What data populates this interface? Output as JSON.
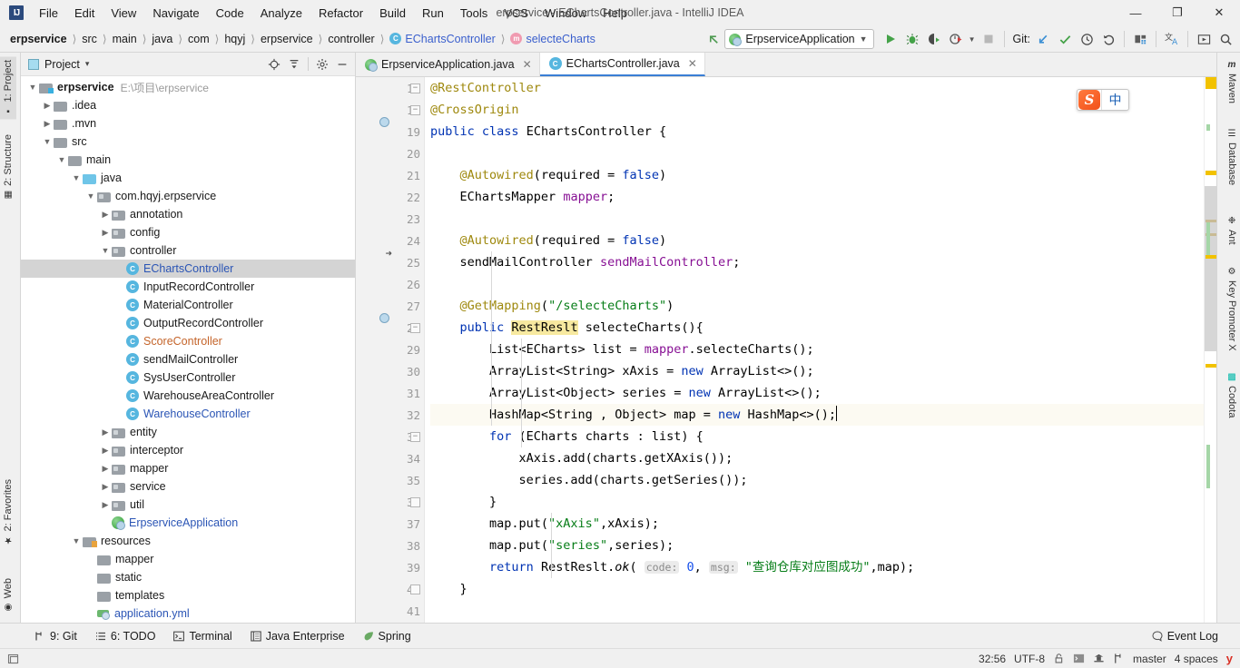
{
  "window": {
    "title": "erpservice - EChartsController.java - IntelliJ IDEA",
    "app_logo": "IJ",
    "minimize": "—",
    "maximize": "❐",
    "close": "✕"
  },
  "menubar": [
    {
      "label": "File",
      "mnemonic": "F"
    },
    {
      "label": "Edit",
      "mnemonic": "E"
    },
    {
      "label": "View",
      "mnemonic": "V"
    },
    {
      "label": "Navigate",
      "mnemonic": "N"
    },
    {
      "label": "Code",
      "mnemonic": "C"
    },
    {
      "label": "Analyze",
      "mnemonic": "z"
    },
    {
      "label": "Refactor",
      "mnemonic": "R"
    },
    {
      "label": "Build",
      "mnemonic": "B"
    },
    {
      "label": "Run",
      "mnemonic": "u"
    },
    {
      "label": "Tools",
      "mnemonic": "T"
    },
    {
      "label": "VCS",
      "mnemonic": "S"
    },
    {
      "label": "Window",
      "mnemonic": "W"
    },
    {
      "label": "Help",
      "mnemonic": "H"
    }
  ],
  "breadcrumbs": [
    {
      "label": "erpservice",
      "style": "bold"
    },
    {
      "label": "src",
      "style": "plain"
    },
    {
      "label": "main",
      "style": "plain"
    },
    {
      "label": "java",
      "style": "plain"
    },
    {
      "label": "com",
      "style": "plain"
    },
    {
      "label": "hqyj",
      "style": "plain"
    },
    {
      "label": "erpservice",
      "style": "plain"
    },
    {
      "label": "controller",
      "style": "plain"
    },
    {
      "label": "EChartsController",
      "style": "class",
      "icon": "C"
    },
    {
      "label": "selecteCharts",
      "style": "method",
      "icon": "m"
    }
  ],
  "toolbar": {
    "run_config": "ErpserviceApplication",
    "git_label": "Git:",
    "icons": [
      "back-arrow-icon",
      "run-icon",
      "debug-icon",
      "run-coverage-icon",
      "profile-icon",
      "stop-icon",
      "update-project-icon",
      "commit-icon",
      "history-icon",
      "rollback-icon",
      "project-structure-icon",
      "translate-icon",
      "presentation-icon",
      "search-everywhere-icon"
    ]
  },
  "left_strip": [
    {
      "label": "1: Project",
      "num": "1",
      "active": true,
      "icon": "project-icon"
    },
    {
      "label": "2: Structure",
      "num": "2",
      "active": false,
      "icon": "structure-icon"
    },
    {
      "label": "2: Favorites",
      "num": "2",
      "active": false,
      "icon": "star-icon"
    },
    {
      "label": "Web",
      "num": "",
      "active": false,
      "icon": "web-icon"
    }
  ],
  "right_strip": [
    {
      "label": "Maven",
      "icon": "maven-icon"
    },
    {
      "label": "Database",
      "icon": "database-icon"
    },
    {
      "label": "Ant",
      "icon": "ant-icon"
    },
    {
      "label": "Key Promoter X",
      "icon": "key-promoter-icon"
    },
    {
      "label": "Codota",
      "icon": "codota-icon"
    }
  ],
  "project_panel": {
    "title": "Project",
    "dropdown": "▾",
    "header_icons": [
      "locate-icon",
      "collapse-all-icon",
      "settings-icon",
      "hide-icon"
    ],
    "tree": [
      {
        "depth": 0,
        "arrow": "▼",
        "icon": "module-folder",
        "label": "erpservice",
        "style": "bold",
        "path": "E:\\项目\\erpservice"
      },
      {
        "depth": 1,
        "arrow": "▶",
        "icon": "folder",
        "label": ".idea",
        "style": "plain"
      },
      {
        "depth": 1,
        "arrow": "▶",
        "icon": "folder",
        "label": ".mvn",
        "style": "plain"
      },
      {
        "depth": 1,
        "arrow": "▼",
        "icon": "folder",
        "label": "src",
        "style": "plain"
      },
      {
        "depth": 2,
        "arrow": "▼",
        "icon": "folder",
        "label": "main",
        "style": "plain"
      },
      {
        "depth": 3,
        "arrow": "▼",
        "icon": "source-folder",
        "label": "java",
        "style": "plain"
      },
      {
        "depth": 4,
        "arrow": "▼",
        "icon": "package",
        "label": "com.hqyj.erpservice",
        "style": "plain"
      },
      {
        "depth": 5,
        "arrow": "▶",
        "icon": "package",
        "label": "annotation",
        "style": "plain"
      },
      {
        "depth": 5,
        "arrow": "▶",
        "icon": "package",
        "label": "config",
        "style": "plain"
      },
      {
        "depth": 5,
        "arrow": "▼",
        "icon": "package",
        "label": "controller",
        "style": "plain"
      },
      {
        "depth": 6,
        "arrow": "",
        "icon": "java-class",
        "label": "EChartsController",
        "style": "link",
        "selected": true
      },
      {
        "depth": 6,
        "arrow": "",
        "icon": "java-class",
        "label": "InputRecordController",
        "style": "plain"
      },
      {
        "depth": 6,
        "arrow": "",
        "icon": "java-class",
        "label": "MaterialController",
        "style": "plain"
      },
      {
        "depth": 6,
        "arrow": "",
        "icon": "java-class",
        "label": "OutputRecordController",
        "style": "plain"
      },
      {
        "depth": 6,
        "arrow": "",
        "icon": "java-class",
        "label": "ScoreController",
        "style": "orange"
      },
      {
        "depth": 6,
        "arrow": "",
        "icon": "java-class",
        "label": "sendMailController",
        "style": "plain"
      },
      {
        "depth": 6,
        "arrow": "",
        "icon": "java-class",
        "label": "SysUserController",
        "style": "plain"
      },
      {
        "depth": 6,
        "arrow": "",
        "icon": "java-class",
        "label": "WarehouseAreaController",
        "style": "plain"
      },
      {
        "depth": 6,
        "arrow": "",
        "icon": "java-class",
        "label": "WarehouseController",
        "style": "link"
      },
      {
        "depth": 5,
        "arrow": "▶",
        "icon": "package",
        "label": "entity",
        "style": "plain"
      },
      {
        "depth": 5,
        "arrow": "▶",
        "icon": "package",
        "label": "interceptor",
        "style": "plain"
      },
      {
        "depth": 5,
        "arrow": "▶",
        "icon": "package",
        "label": "mapper",
        "style": "plain"
      },
      {
        "depth": 5,
        "arrow": "▶",
        "icon": "package",
        "label": "service",
        "style": "plain"
      },
      {
        "depth": 5,
        "arrow": "▶",
        "icon": "package",
        "label": "util",
        "style": "plain"
      },
      {
        "depth": 5,
        "arrow": "",
        "icon": "spring-class",
        "label": "ErpserviceApplication",
        "style": "link"
      },
      {
        "depth": 3,
        "arrow": "▼",
        "icon": "resource-folder",
        "label": "resources",
        "style": "plain"
      },
      {
        "depth": 4,
        "arrow": "",
        "icon": "folder",
        "label": "mapper",
        "style": "plain"
      },
      {
        "depth": 4,
        "arrow": "",
        "icon": "folder",
        "label": "static",
        "style": "plain"
      },
      {
        "depth": 4,
        "arrow": "",
        "icon": "folder",
        "label": "templates",
        "style": "plain"
      },
      {
        "depth": 4,
        "arrow": "",
        "icon": "yaml-file",
        "label": "application.yml",
        "style": "link"
      }
    ]
  },
  "editor": {
    "tabs": [
      {
        "label": "ErpserviceApplication.java",
        "icon": "spring-class",
        "active": false,
        "close": "✕"
      },
      {
        "label": "EChartsController.java",
        "icon": "java-class",
        "active": true,
        "close": "✕"
      }
    ],
    "first_line_number": 17,
    "current_line": 32,
    "lines": [
      {
        "n": 17,
        "gutter": "fold-collapse",
        "tokens": [
          {
            "t": "@RestController",
            "c": "ann"
          }
        ]
      },
      {
        "n": 18,
        "gutter": "fold-collapse",
        "tokens": [
          {
            "t": "@CrossOrigin",
            "c": "ann"
          }
        ]
      },
      {
        "n": 19,
        "gutter": "bean-config",
        "tokens": [
          {
            "t": "public ",
            "c": "kw"
          },
          {
            "t": "class ",
            "c": "kw"
          },
          {
            "t": "EChartsController {",
            "c": "typ"
          }
        ]
      },
      {
        "n": 20,
        "gutter": "",
        "tokens": []
      },
      {
        "n": 21,
        "gutter": "",
        "tokens": [
          {
            "t": "    ",
            "c": "typ"
          },
          {
            "t": "@Autowired",
            "c": "ann"
          },
          {
            "t": "(",
            "c": "typ"
          },
          {
            "t": "required",
            "c": "typ"
          },
          {
            "t": " = ",
            "c": "typ"
          },
          {
            "t": "false",
            "c": "kw"
          },
          {
            "t": ")",
            "c": "typ"
          }
        ]
      },
      {
        "n": 22,
        "gutter": "",
        "tokens": [
          {
            "t": "    EChartsMapper ",
            "c": "typ"
          },
          {
            "t": "mapper",
            "c": "fld"
          },
          {
            "t": ";",
            "c": "typ"
          }
        ]
      },
      {
        "n": 23,
        "gutter": "",
        "tokens": []
      },
      {
        "n": 24,
        "gutter": "",
        "tokens": [
          {
            "t": "    ",
            "c": "typ"
          },
          {
            "t": "@Autowired",
            "c": "ann"
          },
          {
            "t": "(",
            "c": "typ"
          },
          {
            "t": "required",
            "c": "typ"
          },
          {
            "t": " = ",
            "c": "typ"
          },
          {
            "t": "false",
            "c": "kw"
          },
          {
            "t": ")",
            "c": "typ"
          }
        ]
      },
      {
        "n": 25,
        "gutter": "bean-arrow",
        "tokens": [
          {
            "t": "    sendMailController ",
            "c": "typ"
          },
          {
            "t": "sendMailController",
            "c": "fld"
          },
          {
            "t": ";",
            "c": "typ"
          }
        ]
      },
      {
        "n": 26,
        "gutter": "",
        "tokens": []
      },
      {
        "n": 27,
        "gutter": "",
        "tokens": [
          {
            "t": "    ",
            "c": "typ"
          },
          {
            "t": "@GetMapping",
            "c": "ann"
          },
          {
            "t": "(",
            "c": "typ"
          },
          {
            "t": "\"/selecteCharts\"",
            "c": "str"
          },
          {
            "t": ")",
            "c": "typ"
          }
        ]
      },
      {
        "n": 28,
        "gutter": "bean-config",
        "fold": "fold-collapse",
        "tokens": [
          {
            "t": "    ",
            "c": "typ"
          },
          {
            "t": "public ",
            "c": "kw"
          },
          {
            "t": "RestReslt",
            "c": "err"
          },
          {
            "t": " selecteCharts(){",
            "c": "typ"
          }
        ]
      },
      {
        "n": 29,
        "gutter": "",
        "tokens": [
          {
            "t": "        List<ECharts> list = ",
            "c": "typ"
          },
          {
            "t": "mapper",
            "c": "fld"
          },
          {
            "t": ".selecteCharts();",
            "c": "typ"
          }
        ]
      },
      {
        "n": 30,
        "gutter": "",
        "tokens": [
          {
            "t": "        ArrayList<String> xAxis = ",
            "c": "typ"
          },
          {
            "t": "new ",
            "c": "kw"
          },
          {
            "t": "ArrayList<>();",
            "c": "typ"
          }
        ]
      },
      {
        "n": 31,
        "gutter": "",
        "tokens": [
          {
            "t": "        ArrayList<Object> series = ",
            "c": "typ"
          },
          {
            "t": "new ",
            "c": "kw"
          },
          {
            "t": "ArrayList<>();",
            "c": "typ"
          }
        ]
      },
      {
        "n": 32,
        "gutter": "",
        "current": true,
        "tokens": [
          {
            "t": "        HashMap<String , Object> map = ",
            "c": "typ"
          },
          {
            "t": "new ",
            "c": "kw"
          },
          {
            "t": "HashMap<>();",
            "c": "typ"
          }
        ]
      },
      {
        "n": 33,
        "gutter": "",
        "fold": "fold-collapse",
        "tokens": [
          {
            "t": "        ",
            "c": "typ"
          },
          {
            "t": "for ",
            "c": "kw"
          },
          {
            "t": "(ECharts charts : list) {",
            "c": "typ"
          }
        ]
      },
      {
        "n": 34,
        "gutter": "",
        "tokens": [
          {
            "t": "            xAxis.add(charts.getXAxis());",
            "c": "typ"
          }
        ]
      },
      {
        "n": 35,
        "gutter": "",
        "tokens": [
          {
            "t": "            series.add(charts.getSeries());",
            "c": "typ"
          }
        ]
      },
      {
        "n": 36,
        "gutter": "",
        "fold": "fold-end",
        "tokens": [
          {
            "t": "        }",
            "c": "typ"
          }
        ]
      },
      {
        "n": 37,
        "gutter": "",
        "tokens": [
          {
            "t": "        map.put(",
            "c": "typ"
          },
          {
            "t": "\"xAxis\"",
            "c": "str"
          },
          {
            "t": ",xAxis);",
            "c": "typ"
          }
        ]
      },
      {
        "n": 38,
        "gutter": "",
        "tokens": [
          {
            "t": "        map.put(",
            "c": "typ"
          },
          {
            "t": "\"series\"",
            "c": "str"
          },
          {
            "t": ",series);",
            "c": "typ"
          }
        ]
      },
      {
        "n": 39,
        "gutter": "",
        "tokens": [
          {
            "t": "        ",
            "c": "typ"
          },
          {
            "t": "return ",
            "c": "kw"
          },
          {
            "t": "RestReslt.",
            "c": "typ"
          },
          {
            "t": "ok",
            "c": "ital"
          },
          {
            "t": "( ",
            "c": "typ"
          },
          {
            "t": "code:",
            "c": "hint"
          },
          {
            "t": " ",
            "c": "typ"
          },
          {
            "t": "0",
            "c": "num2"
          },
          {
            "t": ", ",
            "c": "typ"
          },
          {
            "t": "msg:",
            "c": "hint"
          },
          {
            "t": " ",
            "c": "typ"
          },
          {
            "t": "\"查询仓库对应图成功\"",
            "c": "str"
          },
          {
            "t": ",map);",
            "c": "typ"
          }
        ]
      },
      {
        "n": 40,
        "gutter": "",
        "fold": "fold-end",
        "tokens": [
          {
            "t": "    }",
            "c": "typ"
          }
        ]
      },
      {
        "n": 41,
        "gutter": "",
        "tokens": []
      }
    ]
  },
  "ime": {
    "logo": "S",
    "mode": "中"
  },
  "bottom_bar": [
    {
      "label": "9: Git",
      "num": "9",
      "icon": "git-branch-icon"
    },
    {
      "label": "6: TODO",
      "num": "6",
      "icon": "todo-list-icon"
    },
    {
      "label": "Terminal",
      "num": "",
      "icon": "terminal-icon"
    },
    {
      "label": "Java Enterprise",
      "num": "",
      "icon": "java-ee-icon"
    },
    {
      "label": "Spring",
      "num": "",
      "icon": "spring-leaf-icon"
    }
  ],
  "event_log": {
    "label": "Event Log",
    "icon": "balloon-icon"
  },
  "status_bar": {
    "caret_position": "32:56",
    "encoding": "UTF-8",
    "line_separator_icon": "lock-icon",
    "icons": [
      "terminal-status-icon",
      "inspection-hat-icon"
    ],
    "branch": "master",
    "indent": "4 spaces",
    "vcs_icon": "branch-icon",
    "right_icon": "y"
  },
  "colors": {
    "accent_blue": "#3a7fd5",
    "keyword_blue": "#0033b3",
    "string_green": "#067d17",
    "annotation_gold": "#9e880d",
    "field_purple": "#871094",
    "error_highlight": "#f7e9a0",
    "chrome_gray": "#f0f0f0",
    "selection_gray": "#d4d4d4"
  }
}
